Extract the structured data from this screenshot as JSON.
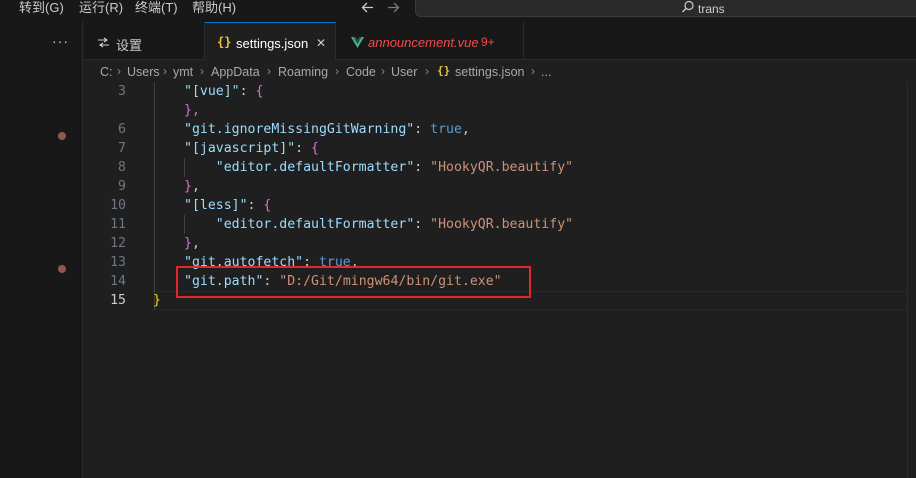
{
  "menu": [
    {
      "label": "转到(G)"
    },
    {
      "label": "运行(R)"
    },
    {
      "label": "终端(T)"
    },
    {
      "label": "帮助(H)"
    }
  ],
  "nav": {
    "back_icon": "arrow-left-icon",
    "forward_icon": "arrow-right-icon"
  },
  "command_center": {
    "text": "trans",
    "icon": "search-icon"
  },
  "sidebar": {
    "more": "···"
  },
  "tabs": [
    {
      "label": "设置",
      "icon": "settings-icon"
    },
    {
      "label": "settings.json",
      "icon": "json-braces-icon",
      "close": "✕"
    },
    {
      "label": "announcement.vue",
      "badge": "9+",
      "icon": "vue-icon"
    }
  ],
  "breadcrumb": [
    "C:",
    "Users",
    "ymt",
    "AppData",
    "Roaming",
    "Code",
    "User",
    "settings.json",
    "..."
  ],
  "editor": {
    "lines": [
      {
        "n": "3",
        "tokens": [
          [
            "k",
            "\"[vue]\""
          ],
          [
            "p",
            ": "
          ],
          [
            "b1",
            "{"
          ]
        ]
      },
      {
        "n": "",
        "tokens": [
          [
            "b1",
            "},"
          ]
        ]
      },
      {
        "n": "6",
        "tokens": [
          [
            "k",
            "\"git.ignoreMissingGitWarning\""
          ],
          [
            "p",
            ": "
          ],
          [
            "lit",
            "true"
          ],
          [
            "p",
            ","
          ]
        ]
      },
      {
        "n": "7",
        "tokens": [
          [
            "k",
            "\"[javascript]\""
          ],
          [
            "p",
            ": "
          ],
          [
            "b1",
            "{"
          ]
        ]
      },
      {
        "n": "8",
        "tokens": [
          [
            "p",
            "    "
          ],
          [
            "k",
            "\"editor.defaultFormatter\""
          ],
          [
            "p",
            ": "
          ],
          [
            "s",
            "\"HookyQR.beautify\""
          ]
        ]
      },
      {
        "n": "9",
        "tokens": [
          [
            "b1",
            "}"
          ],
          [
            "p",
            ","
          ]
        ]
      },
      {
        "n": "10",
        "tokens": [
          [
            "k",
            "\"[less]\""
          ],
          [
            "p",
            ": "
          ],
          [
            "b1",
            "{"
          ]
        ]
      },
      {
        "n": "11",
        "tokens": [
          [
            "p",
            "    "
          ],
          [
            "k",
            "\"editor.defaultFormatter\""
          ],
          [
            "p",
            ": "
          ],
          [
            "s",
            "\"HookyQR.beautify\""
          ]
        ]
      },
      {
        "n": "12",
        "tokens": [
          [
            "b1",
            "}"
          ],
          [
            "p",
            ","
          ]
        ]
      },
      {
        "n": "13",
        "tokens": [
          [
            "k",
            "\"git.autofetch\""
          ],
          [
            "p",
            ": "
          ],
          [
            "lit",
            "true"
          ],
          [
            "p",
            ","
          ]
        ]
      },
      {
        "n": "14",
        "tokens": [
          [
            "k",
            "\"git.path\""
          ],
          [
            "p",
            ": "
          ],
          [
            "s",
            "\"D:/Git/mingw64/bin/git.exe\""
          ]
        ]
      },
      {
        "n": "15",
        "tokens": [
          [
            "b0",
            "}"
          ]
        ],
        "active": true
      }
    ]
  },
  "colors": {
    "accent": "#0078d4",
    "highlight": "#e1262c",
    "vue_green": "#41b883",
    "vue_modified": "#f14c4c"
  }
}
